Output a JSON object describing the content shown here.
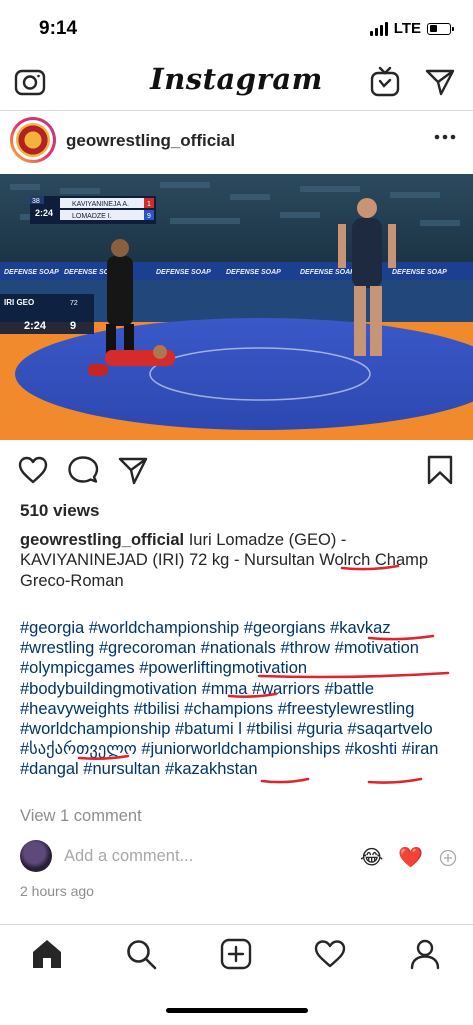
{
  "status_bar": {
    "time": "9:14",
    "network": "LTE"
  },
  "top_nav": {
    "brand": "Instagram"
  },
  "post": {
    "username": "geowrestling_official",
    "video": {
      "scoreboard_top": {
        "row1_name": "KAVIYANINEJA A.",
        "row1_score": "1",
        "row2_name": "LOMADZE I.",
        "row2_score": "9",
        "clock": "2:24",
        "weight": "38"
      },
      "scoreboard_mini": {
        "teams": "IRI GEO",
        "clock": "2:24",
        "score": "9",
        "weight_class": "72"
      },
      "banner_text": "DEFENSE SOAP"
    },
    "views": "510 views",
    "caption": {
      "user": "geowrestling_official",
      "text": " Iuri Lomadze (GEO) - KAVIYANINEJAD (IRI) 72 kg - Nursultan Wolrch Champ Greco-Roman"
    },
    "hashtags": "#georgia #worldchampionship #georgians #kavkaz #wrestling #grecoroman #nationals #throw #motivation #olympicgames  #powerliftingmotivation #bodybuildingmotivation #mma #warriors #battle #heavyweights #tbilisi #champions #freestylewrestling #worldchampionship #batumi l #tbilisi #guria #saqartvelo #საქართველო #juniorworldchampionships #koshti #iran #dangal #nursultan #kazakhstan",
    "view_comments": "View 1 comment",
    "add_comment_placeholder": "Add a comment...",
    "emojis": [
      "😂",
      "❤️"
    ],
    "timestamp": "2 hours ago"
  },
  "colors": {
    "underline": "#e0242d",
    "hashtag": "#003569",
    "muted": "#8e8e8e"
  },
  "icons": [
    "camera-icon",
    "igtv-icon",
    "direct-message-icon",
    "more-options-icon",
    "like-icon",
    "comment-icon",
    "share-icon",
    "save-bookmark-icon",
    "plus-icon",
    "home-icon",
    "search-icon",
    "new-post-icon",
    "activity-heart-icon",
    "profile-icon"
  ]
}
